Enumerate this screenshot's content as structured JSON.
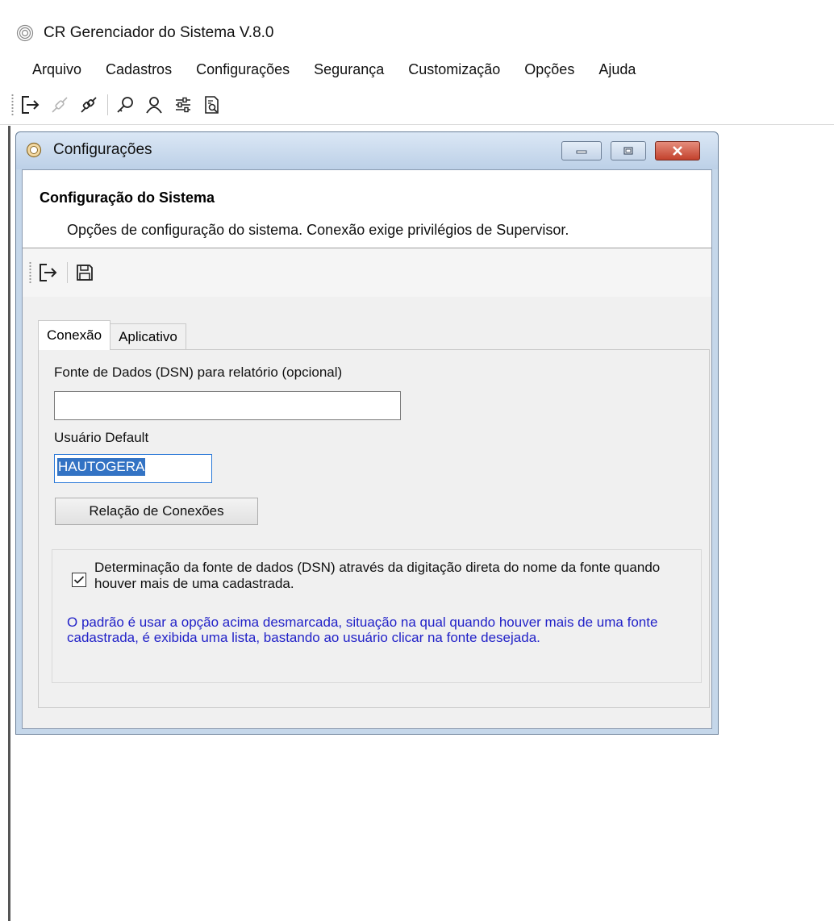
{
  "app": {
    "title": "CR Gerenciador do Sistema V.8.0",
    "icon": "app-logo-icon"
  },
  "menu": {
    "items": [
      "Arquivo",
      "Cadastros",
      "Configurações",
      "Segurança",
      "Customização",
      "Opções",
      "Ajuda"
    ]
  },
  "toolbar": {
    "buttons": [
      "exit-icon",
      "disconnect-icon",
      "connect-icon",
      "key-icon",
      "user-icon",
      "settings-sliders-icon",
      "report-preview-icon"
    ]
  },
  "child_window": {
    "title": "Configurações",
    "header_title": "Configuração do Sistema",
    "header_description": "Opções de configuração do sistema. Conexão exige privilégios de Supervisor.",
    "toolbar_buttons": [
      "exit-icon",
      "save-icon"
    ],
    "tabs": [
      "Conexão",
      "Aplicativo"
    ],
    "active_tab": "Conexão",
    "dsn_label": "Fonte de Dados (DSN) para relatório (opcional)",
    "dsn_value": "",
    "user_label": "Usuário Default",
    "user_value": "HAUTOGERA",
    "connections_button": "Relação de Conexões",
    "checkbox_checked": true,
    "checkbox_text": "Determinação da fonte de dados (DSN) através da digitação direta do nome da fonte quando houver mais de uma cadastrada.",
    "info_text": "O padrão é usar a opção acima desmarcada, situação na qual quando houver mais de uma fonte cadastrada, é exibida uma lista, bastando ao usuário clicar na fonte desejada."
  },
  "colors": {
    "info_text": "#2222c8",
    "selection": "#3373c4",
    "title_bar": "#c5d7ea",
    "close_button": "#c3412c"
  }
}
